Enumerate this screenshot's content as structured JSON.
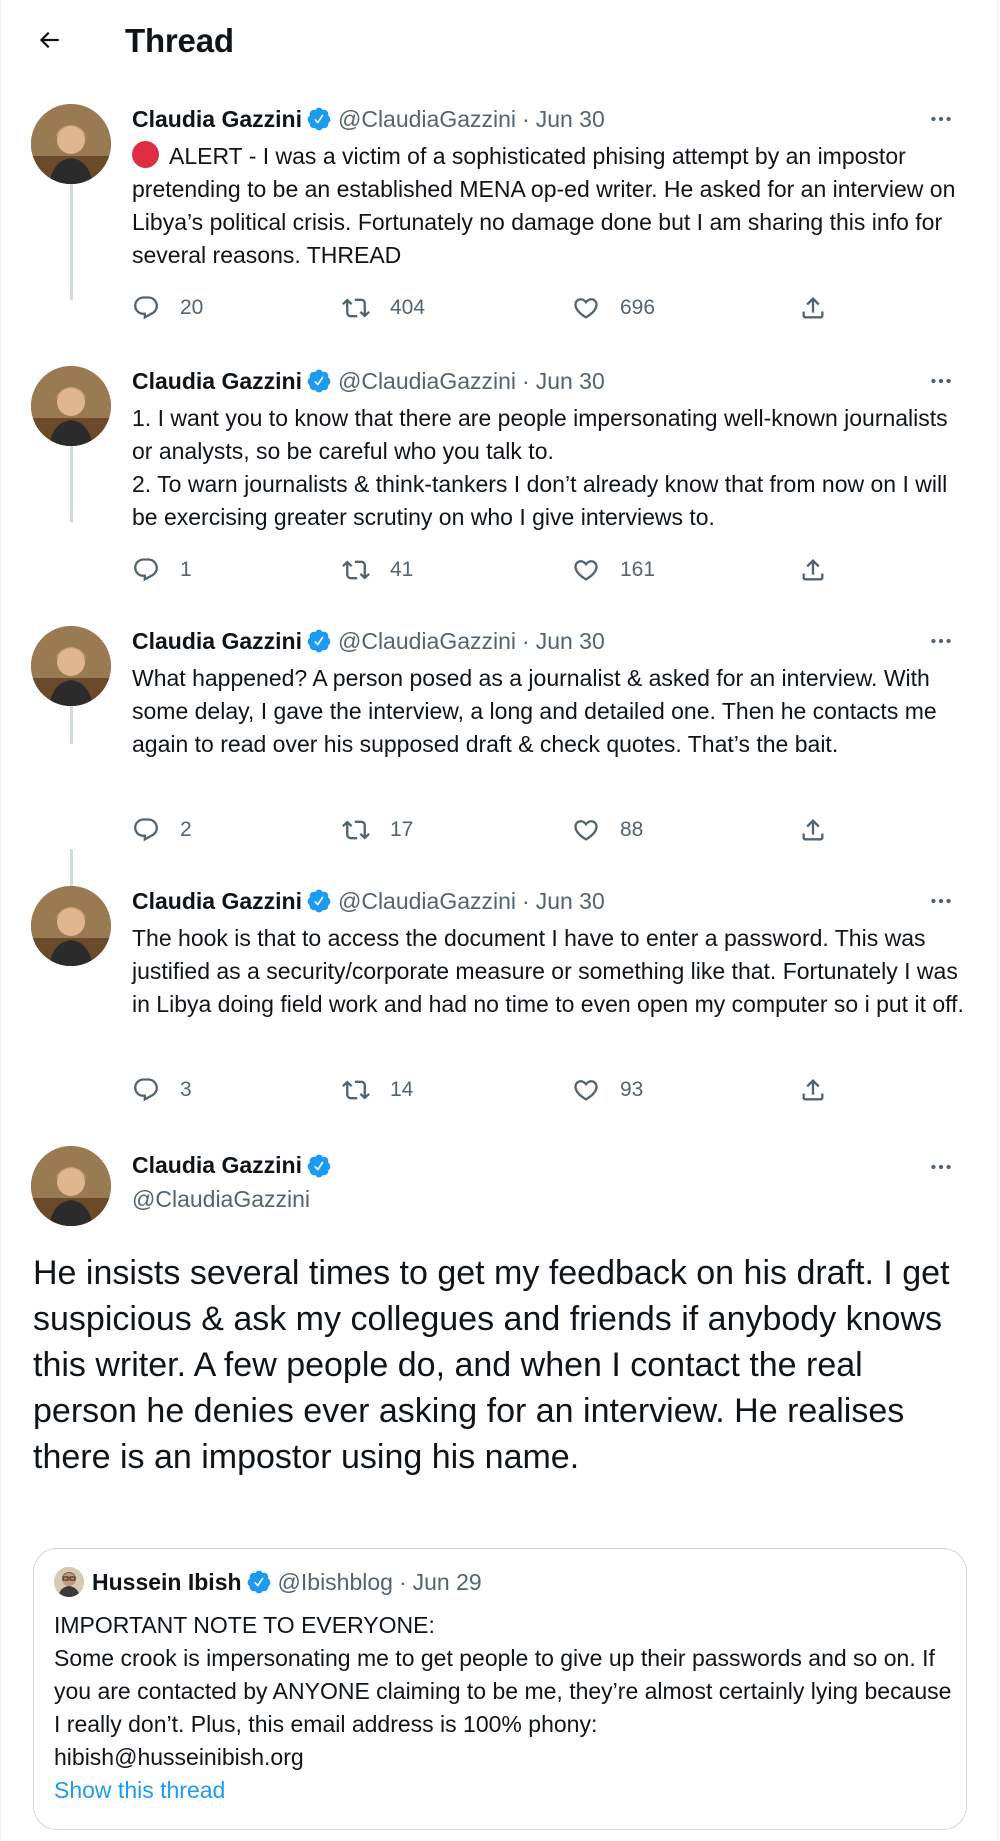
{
  "header": {
    "title": "Thread",
    "back_icon": "arrow-left-icon"
  },
  "colors": {
    "verified": "#1d9bf0",
    "secondary_text": "#536471",
    "link": "#1d9bf0",
    "alert": "#dd2e44",
    "thread_line": "#cfd9de"
  },
  "tweets": [
    {
      "name": "Claudia Gazzini",
      "handle": "@ClaudiaGazzini",
      "dot": "·",
      "date": "Jun 30",
      "text": "ALERT - I was a victim of a sophisticated phising attempt by an impostor pretending to be an established MENA op-ed writer. He asked for an interview on Libya’s political crisis. Fortunately no damage done but I am sharing this info for several reasons. THREAD",
      "replies": "20",
      "retweets": "404",
      "likes": "696"
    },
    {
      "name": "Claudia Gazzini",
      "handle": "@ClaudiaGazzini",
      "dot": "·",
      "date": "Jun 30",
      "text": "1. I want you to know that there are people impersonating well-known journalists or analysts, so be careful who you talk to.\n2. To warn journalists & think-tankers I don’t already know that from now on I will be exercising greater scrutiny on who I give interviews to.",
      "replies": "1",
      "retweets": "41",
      "likes": "161"
    },
    {
      "name": "Claudia Gazzini",
      "handle": "@ClaudiaGazzini",
      "dot": "·",
      "date": "Jun 30",
      "text": "What happened? A person posed as a journalist & asked for an interview. With some delay, I gave the interview, a long and detailed one. Then he contacts me again to read over his supposed draft & check quotes. That’s the bait.",
      "replies": "2",
      "retweets": "17",
      "likes": "88"
    },
    {
      "name": "Claudia Gazzini",
      "handle": "@ClaudiaGazzini",
      "dot": "·",
      "date": "Jun 30",
      "text": "The hook is that to access the document I have to enter a password. This was justified as a security/corporate measure or something like that. Fortunately I was in Libya doing field work and had no time to even open my computer so i put it off.",
      "replies": "3",
      "retweets": "14",
      "likes": "93"
    }
  ],
  "main_tweet": {
    "name": "Claudia Gazzini",
    "handle": "@ClaudiaGazzini",
    "text": "He insists several times to get my feedback on his draft. I get suspicious & ask my collegues and friends if anybody knows this writer. A few people do, and when I contact the real person he denies ever asking for an interview. He realises there is an impostor using his name."
  },
  "quoted_tweet": {
    "name": "Hussein Ibish",
    "handle": "@Ibishblog",
    "dot": "·",
    "date": "Jun 29",
    "text": "IMPORTANT NOTE TO EVERYONE:\nSome crook is impersonating me to get people to give up their passwords and so on. If you are contacted by ANYONE claiming to be me, they’re almost certainly lying because I really don’t. Plus, this email address is 100% phony:\nhibish@husseinibish.org",
    "show_thread": "Show this thread"
  }
}
